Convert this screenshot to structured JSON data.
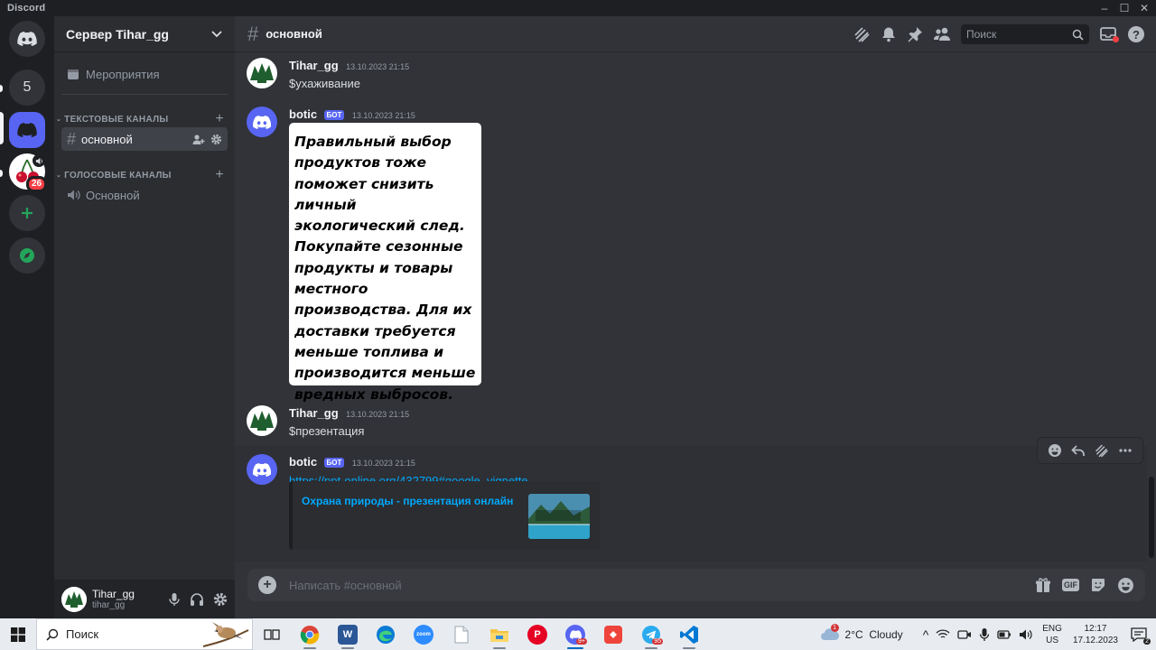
{
  "window": {
    "title": "Discord",
    "controls": [
      "minimize",
      "maximize",
      "close"
    ]
  },
  "servers": {
    "items": [
      {
        "name": "home",
        "icon": "discord-logo-icon"
      },
      {
        "name": "server-5",
        "label": "5"
      },
      {
        "name": "server-selected",
        "icon": "discord-logo-icon"
      },
      {
        "name": "server-cherries",
        "icon": "cherries-icon",
        "badge": "26"
      },
      {
        "name": "add-server",
        "icon": "plus-icon"
      },
      {
        "name": "explore",
        "icon": "compass-icon"
      }
    ]
  },
  "sidebar": {
    "server_name": "Сервер Tihar_gg",
    "events_label": "Мероприятия",
    "text_category": "ТЕКСТОВЫЕ КАНАЛЫ",
    "text_channels": [
      {
        "name": "основной",
        "active": true
      }
    ],
    "voice_category": "ГОЛОСОВЫЕ КАНАЛЫ",
    "voice_channels": [
      {
        "name": "Основной"
      }
    ]
  },
  "user": {
    "display_name": "Tihar_gg",
    "username": "tihar_gg"
  },
  "channel": {
    "name": "основной",
    "search_placeholder": "Поиск"
  },
  "messages": [
    {
      "author": "Tihar_gg",
      "time": "13.10.2023 21:15",
      "text": "$ухаживание",
      "bot": false
    },
    {
      "author": "botic",
      "bot_label": "БОТ",
      "time": "13.10.2023 21:15",
      "image_text": "Правильный выбор продуктов тоже поможет снизить личный экологический след. Покупайте сезонные продукты и товары местного производства. Для их доставки требуется меньше топлива и производится меньше вредных выбросов.",
      "bot": true
    },
    {
      "author": "Tihar_gg",
      "time": "13.10.2023 21:15",
      "text": "$презентация",
      "bot": false
    },
    {
      "author": "botic",
      "bot_label": "БОТ",
      "time": "13.10.2023 21:15",
      "link": "https://ppt-online.org/432799#google_vignette",
      "embed_title": "Охрана природы - презентация онлайн",
      "bot": true
    }
  ],
  "composer": {
    "placeholder": "Написать #основной",
    "gif_label": "GIF"
  },
  "taskbar": {
    "search_label": "Поиск",
    "apps": [
      {
        "name": "task-view",
        "label": ""
      },
      {
        "name": "chrome",
        "label": ""
      },
      {
        "name": "word",
        "label": "W"
      },
      {
        "name": "edge",
        "label": ""
      },
      {
        "name": "zoom",
        "label": "zoom"
      },
      {
        "name": "notepad",
        "label": ""
      },
      {
        "name": "explorer",
        "label": ""
      },
      {
        "name": "pinterest",
        "label": "P"
      },
      {
        "name": "discord",
        "label": "",
        "count": "9+"
      },
      {
        "name": "anydesk",
        "label": ""
      },
      {
        "name": "telegram",
        "label": "",
        "count": "95"
      },
      {
        "name": "vscode",
        "label": ""
      }
    ],
    "weather": "2°C  Cloudy",
    "weather_alert": "1",
    "lang_top": "ENG",
    "lang_bottom": "US",
    "time": "12:17",
    "date": "17.12.2023",
    "notifications": "2"
  },
  "colors": {
    "blurple": "#5865f2",
    "link": "#00a8fc",
    "danger": "#f23f43",
    "green": "#23a55a"
  }
}
